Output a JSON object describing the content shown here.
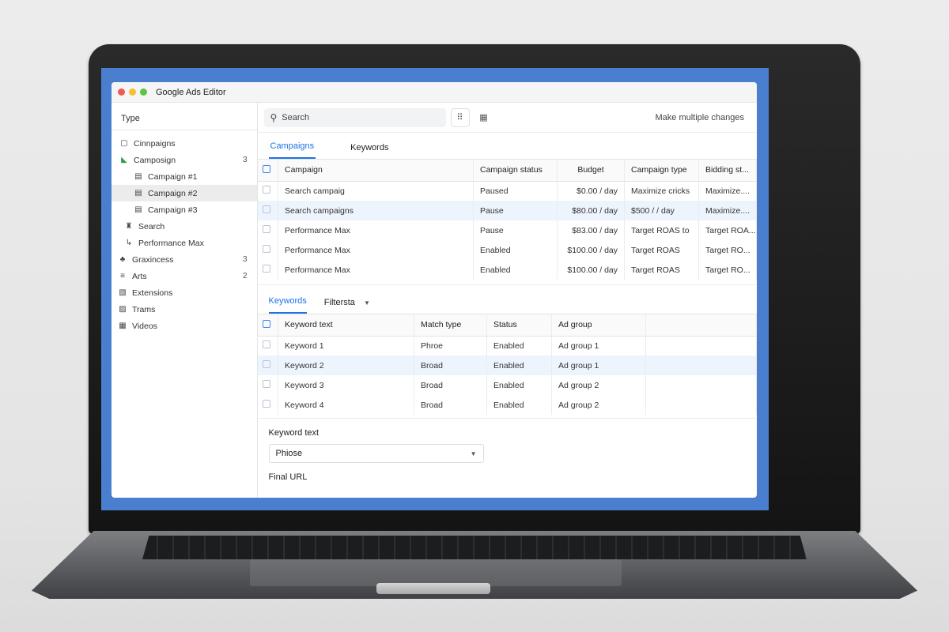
{
  "window": {
    "title": "Google Ads Editor",
    "traffic_colors": [
      "#ee5b57",
      "#f5bf2f",
      "#5cc443"
    ]
  },
  "sidebar": {
    "header": "Type",
    "items": [
      {
        "label": "Cinnpaigns",
        "count": "",
        "icon": "campaign-folder-icon",
        "glyph": "▢"
      },
      {
        "label": "Camposign",
        "count": "3",
        "icon": "green-tag-icon",
        "glyph": "◣"
      },
      {
        "label": "Campaign #1",
        "count": "",
        "icon": "document-icon",
        "glyph": "▤"
      },
      {
        "label": "Campaign #2",
        "count": "",
        "icon": "document-icon",
        "glyph": "▤"
      },
      {
        "label": "Campaign #3",
        "count": "",
        "icon": "document-icon",
        "glyph": "▤"
      },
      {
        "label": "Search",
        "count": "",
        "icon": "search-campaign-icon",
        "glyph": "♜"
      },
      {
        "label": "Performance Max",
        "count": "",
        "icon": "performance-icon",
        "glyph": "↳"
      },
      {
        "label": "Graxincess",
        "count": "3",
        "icon": "group-icon",
        "glyph": "♣"
      },
      {
        "label": "Arts",
        "count": "2",
        "icon": "ads-icon",
        "glyph": "≡"
      },
      {
        "label": "Extensions",
        "count": "",
        "icon": "extensions-icon",
        "glyph": "▧"
      },
      {
        "label": "Trams",
        "count": "",
        "icon": "teams-icon",
        "glyph": "▨"
      },
      {
        "label": "Videos",
        "count": "",
        "icon": "videos-icon",
        "glyph": "▦"
      }
    ],
    "selected_index": 3
  },
  "toolbar": {
    "search_placeholder": "Search",
    "multi_label": "Make multiple changes"
  },
  "tabs": [
    "Campaigns",
    "Keywords"
  ],
  "campaigns_table": {
    "headers": [
      "Campaign",
      "Campaign status",
      "Budget",
      "Campaign type",
      "Bidding st..."
    ],
    "rows": [
      [
        "Search campaig",
        "Paused",
        "$0.00 / day",
        "Maximize cricks",
        "Maximize...."
      ],
      [
        "Search campaigns",
        "Pause",
        "$80.00 / day",
        "$500 / / day",
        "Maximize...."
      ],
      [
        "Performance Max",
        "Pause",
        "$83.00 / day",
        "Target ROAS to",
        "Target ROA..."
      ],
      [
        "Performance Max",
        "Enabled",
        "$100.00 / day",
        "Target ROAS",
        "Target RO..."
      ],
      [
        "Performance Max",
        "Enabled",
        "$100.00 / day",
        "Target ROAS",
        "Target RO..."
      ]
    ],
    "highlight_row": 1
  },
  "sub_tabs": {
    "items": [
      "Keywords",
      "Filtersta"
    ]
  },
  "keywords_table": {
    "headers": [
      "Keyword text",
      "Match type",
      "Status",
      "Ad group"
    ],
    "rows": [
      [
        "Keyword 1",
        "Phroe",
        "Enabled",
        "Ad group 1"
      ],
      [
        "Keyword 2",
        "Broad",
        "Enabled",
        "Ad group 1"
      ],
      [
        "Keyword 3",
        "Broad",
        "Enabled",
        "Ad group 2"
      ],
      [
        "Keyword 4",
        "Broad",
        "Enabled",
        "Ad group 2"
      ]
    ],
    "highlight_row": 1
  },
  "form": {
    "keyword_label": "Keyword text",
    "select_value": "Phiose",
    "final_url_label": "Final URL"
  },
  "colors": {
    "accent": "#1a73e8",
    "screen_blue": "#4a7fd0",
    "row_highlight": "#eef4fd"
  }
}
